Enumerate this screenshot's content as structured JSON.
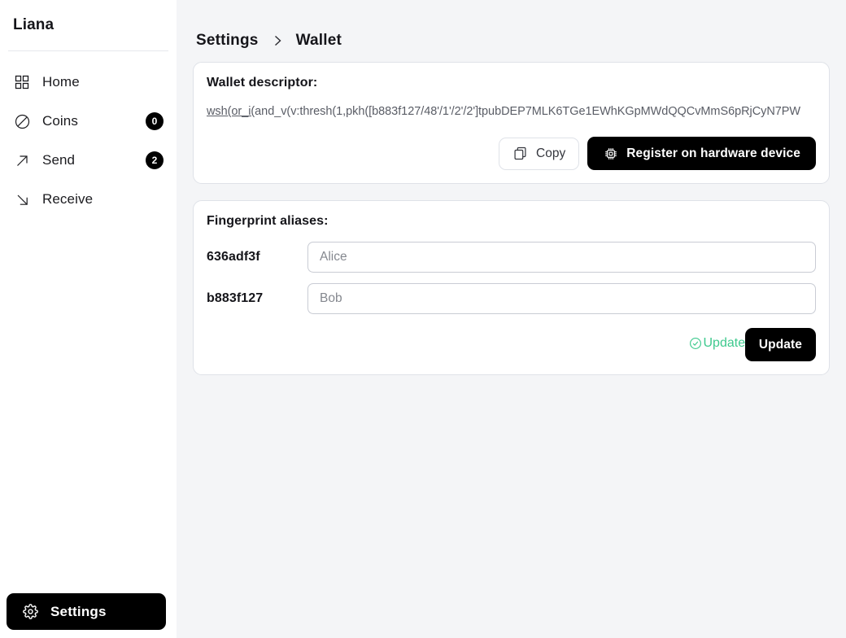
{
  "sidebar": {
    "brand": "Liana",
    "items": [
      {
        "label": "Home",
        "icon": "grid-icon",
        "badge": null
      },
      {
        "label": "Coins",
        "icon": "circle-slash-icon",
        "badge": "0"
      },
      {
        "label": "Send",
        "icon": "arrow-up-right-icon",
        "badge": "2"
      },
      {
        "label": "Receive",
        "icon": "arrow-down-right-icon",
        "badge": null
      }
    ],
    "settings": {
      "label": "Settings",
      "icon": "gear-icon"
    }
  },
  "breadcrumb": {
    "parent": "Settings",
    "separator": "chevron-right-icon",
    "current": "Wallet"
  },
  "descriptor_card": {
    "title": "Wallet descriptor:",
    "value_underlined": "wsh(or_i(",
    "value_rest": "and_v(v:thresh(1,pkh([b883f127/48'/1'/2'/2']tpubDEP7MLK6TGe1EWhKGpMWdQQCvMmS6pRjCyN7PW",
    "copy_label": "Copy",
    "copy_icon": "copy-icon",
    "register_label": "Register on hardware device",
    "register_icon": "chip-icon"
  },
  "aliases_card": {
    "title": "Fingerprint aliases:",
    "rows": [
      {
        "fingerprint": "636adf3f",
        "value": "",
        "placeholder": "Alice"
      },
      {
        "fingerprint": "b883f127",
        "value": "",
        "placeholder": "Bob"
      }
    ],
    "status_label": "Updated",
    "status_icon": "check-circle-icon",
    "status_color": "#3ec98e",
    "update_label": "Update"
  },
  "colors": {
    "accent_dark": "#000000",
    "page_bg": "#f4f5f7",
    "card_bg": "#ffffff",
    "border": "#dfe2e8",
    "success": "#3ec98e"
  }
}
